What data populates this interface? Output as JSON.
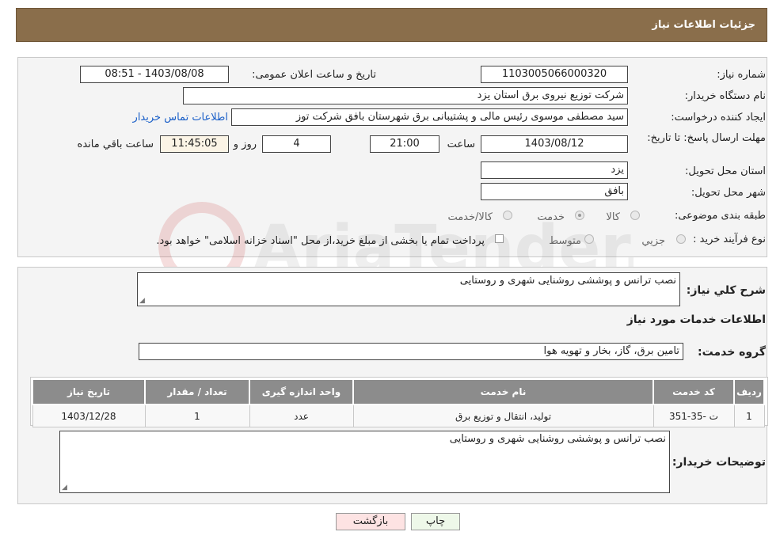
{
  "header": {
    "title": "جزئیات اطلاعات نیاز"
  },
  "fields": {
    "need_number_label": "شماره نیاز:",
    "need_number": "1103005066000320",
    "announce_label": "تاریخ و ساعت اعلان عمومی:",
    "announce_value": "1403/08/08 - 08:51",
    "buyer_label": "نام دستگاه خریدار:",
    "buyer_value": "شرکت توزیع نیروی برق استان یزد",
    "creator_label": "ایجاد کننده درخواست:",
    "creator_value": "سید مصطفی  موسوی  رئیس مالی و پشتیبانی برق شهرستان بافق شرکت توز",
    "contact_link": "اطلاعات تماس خریدار",
    "deadline_label": "مهلت ارسال پاسخ: تا تاریخ:",
    "deadline_date": "1403/08/12",
    "time_label": "ساعت",
    "deadline_time": "21:00",
    "days_value": "4",
    "days_label": "روز و",
    "remaining_time": "11:45:05",
    "remaining_label": "ساعت باقي مانده",
    "province_label": "استان محل تحویل:",
    "province_value": "یزد",
    "city_label": "شهر محل تحویل:",
    "city_value": "بافق",
    "category_label": "طبقه بندی موضوعی:",
    "category_options": [
      "کالا",
      "خدمت",
      "کالا/خدمت"
    ],
    "purchase_label": "نوع فرآیند خرید :",
    "purchase_options": [
      "جزیي",
      "متوسط"
    ],
    "purchase_note": "پرداخت تمام یا بخشی از مبلغ خرید،از محل \"اسناد خزانه اسلامی\" خواهد بود."
  },
  "summary": {
    "label": "شرح کلي نیاز:",
    "value": "نصب ترانس و پوششی روشنایی شهری و روستایی"
  },
  "services": {
    "section_title": "اطلاعات خدمات مورد نیاز",
    "group_label": "گروه خدمت:",
    "group_value": "تامین برق، گاز، بخار و تهویه هوا",
    "columns": [
      "ردیف",
      "کد خدمت",
      "نام خدمت",
      "واحد اندازه گیری",
      "تعداد / مقدار",
      "تاریخ نیاز"
    ],
    "rows": [
      [
        "1",
        "ت -35-351",
        "تولید، انتقال و توزیع برق",
        "عدد",
        "1",
        "1403/12/28"
      ]
    ]
  },
  "buyer_notes": {
    "label": "توضیحات خریدار:",
    "value": "نصب ترانس و پوششی روشنایی شهری و روستایی"
  },
  "buttons": {
    "print": "چاپ",
    "back": "بازگشت"
  },
  "colors": {
    "header_bg": "#8a6e4b",
    "table_header_bg": "#8c8c8c",
    "link": "#1a5fc8"
  },
  "watermark_text": "AriaTender.neT"
}
